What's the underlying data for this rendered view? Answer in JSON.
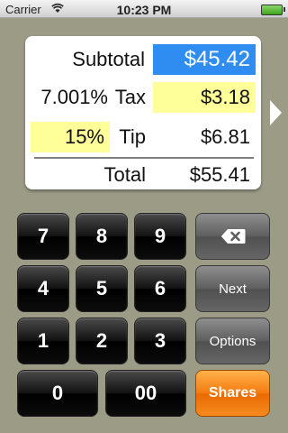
{
  "status_bar": {
    "carrier": "Carrier",
    "time": "10:23 PM"
  },
  "display": {
    "subtotal_label": "Subtotal",
    "subtotal_value": "$45.42",
    "tax_rate": "7.001%",
    "tax_label": "Tax",
    "tax_value": "$3.18",
    "tip_rate": "15%",
    "tip_label": "Tip",
    "tip_value": "$6.81",
    "total_label": "Total",
    "total_value": "$55.41"
  },
  "keypad": {
    "k7": "7",
    "k8": "8",
    "k9": "9",
    "k4": "4",
    "k5": "5",
    "k6": "6",
    "k1": "1",
    "k2": "2",
    "k3": "3",
    "k0": "0",
    "k00": "00",
    "next": "Next",
    "options": "Options",
    "shares": "Shares"
  },
  "icons": {
    "backspace": "backspace-icon",
    "next_page": "chevron-right-icon",
    "wifi": "wifi-icon",
    "battery": "battery-icon"
  },
  "colors": {
    "background": "#9c9b86",
    "subtotal_highlight": "#2f8cf0",
    "input_highlight": "#ffff99",
    "shares_button": "#f47a10"
  }
}
